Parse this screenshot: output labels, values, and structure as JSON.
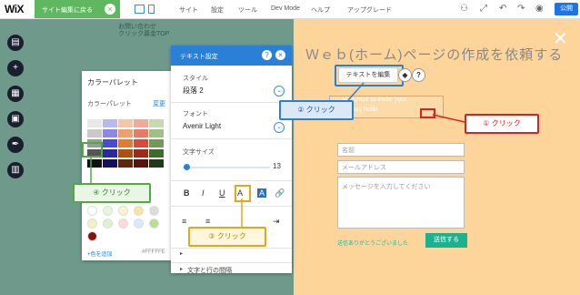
{
  "topbar": {
    "logo": "WiX",
    "back_label": "サイト編集に戻る",
    "back_close": "×",
    "menu": [
      "サイト",
      "設定",
      "ツール",
      "Dev Mode",
      "ヘルプ",
      "アップグレード"
    ],
    "publish": "公開"
  },
  "background_texts": [
    "お問い合わせ",
    "クリック募金TOP"
  ],
  "canvas": {
    "hero_title": "Ｗｅｂ(ホーム)ページの作成を依頼する",
    "close_glyph": "✕",
    "edit_text_button": "テキストを編集",
    "hint_line1": "...ain space to invite your",
    "hint_line2": "...rs to say hello.",
    "form": {
      "name_placeholder": "名前",
      "email_placeholder": "メールアドレス",
      "message_placeholder": "メッセージを入力してください",
      "thanks": "送信ありがとうございました",
      "submit": "送信する"
    }
  },
  "color_palette": {
    "title": "カラーパレット",
    "subtitle": "カラーパレット",
    "change": "変更",
    "add_color": "+色を追加",
    "hex": "#FFFFFE"
  },
  "text_settings": {
    "title": "テキスト設定",
    "help": "?",
    "close": "×",
    "style_label": "スタイル",
    "style_value": "段落 2",
    "font_label": "フォント",
    "font_value": "Avenir Light",
    "size_label": "文字サイズ",
    "size_value": "13",
    "format_buttons": [
      "B",
      "I",
      "U",
      "A",
      "A",
      "🔗"
    ],
    "section": "文字と行の間隔"
  },
  "callouts": {
    "c1": "① クリック",
    "c2": "② クリック",
    "c3": "③ クリック",
    "c4": "④ クリック"
  },
  "colors": {
    "accent": "#2a7fd6",
    "publish": "#1d74e5",
    "submit": "#19b391",
    "callout1": "#e02020",
    "callout3": "#e8a41b",
    "callout4": "#4cad3c",
    "canvas_bg": "#fdd59a"
  }
}
